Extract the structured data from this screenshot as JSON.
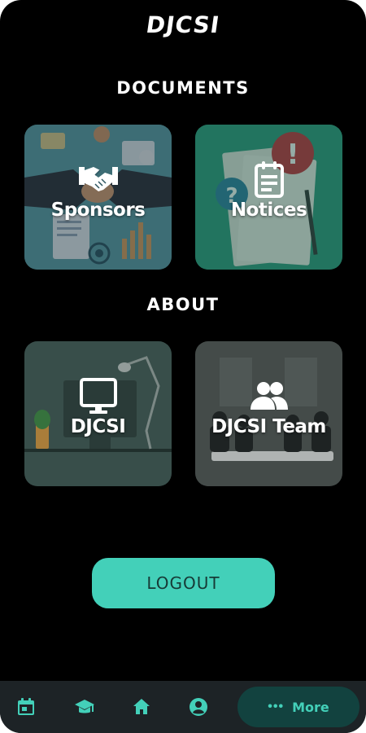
{
  "app": {
    "logo_text": "DJCSI"
  },
  "documents": {
    "title": "DOCUMENTS",
    "cards": [
      {
        "label": "Sponsors",
        "icon": "handshake-icon"
      },
      {
        "label": "Notices",
        "icon": "notice-board-icon"
      }
    ]
  },
  "about": {
    "title": "ABOUT",
    "cards": [
      {
        "label": "DJCSI",
        "icon": "monitor-icon"
      },
      {
        "label": "DJCSI Team",
        "icon": "group-icon"
      }
    ]
  },
  "logout_label": "LOGOUT",
  "bottom_nav": {
    "items": [
      "calendar-icon",
      "graduation-cap-icon",
      "home-icon",
      "account-icon"
    ],
    "more_label": "More",
    "more_icon": "more-dots-icon"
  },
  "colors": {
    "accent": "#43d0b9",
    "background": "#000000",
    "nav_background": "#1d2326",
    "more_pill": "#12423f"
  }
}
